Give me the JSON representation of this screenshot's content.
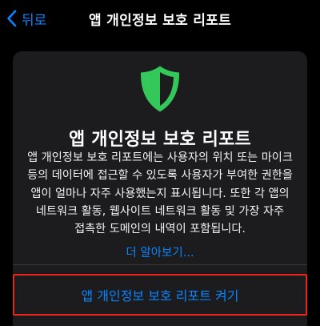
{
  "nav": {
    "back_label": "뒤로",
    "title": "앱 개인정보 보호 리포트"
  },
  "card": {
    "icon": "shield-icon",
    "title": "앱 개인정보 보호 리포트",
    "body": "앱 개인정보 보호 리포트에는 사용자의 위치 또는 마이크 등의 데이터에 접근할 수 있도록 사용자가 부여한 권한을 앱이 얼마나 자주 사용했는지 표시됩니다. 또한 각 앱의 네트워크 활동, 웹사이트 네트워크 활동 및 가장 자주 접촉한 도메인의 내역이 포함됩니다.",
    "learn_more": "더 알아보기...",
    "action_label": "앱 개인정보 보호 리포트 켜기"
  },
  "colors": {
    "background": "#000000",
    "card": "#1c1c1e",
    "accent": "#0a84ff",
    "shield": "#34c759",
    "highlight_border": "#e8251a"
  }
}
